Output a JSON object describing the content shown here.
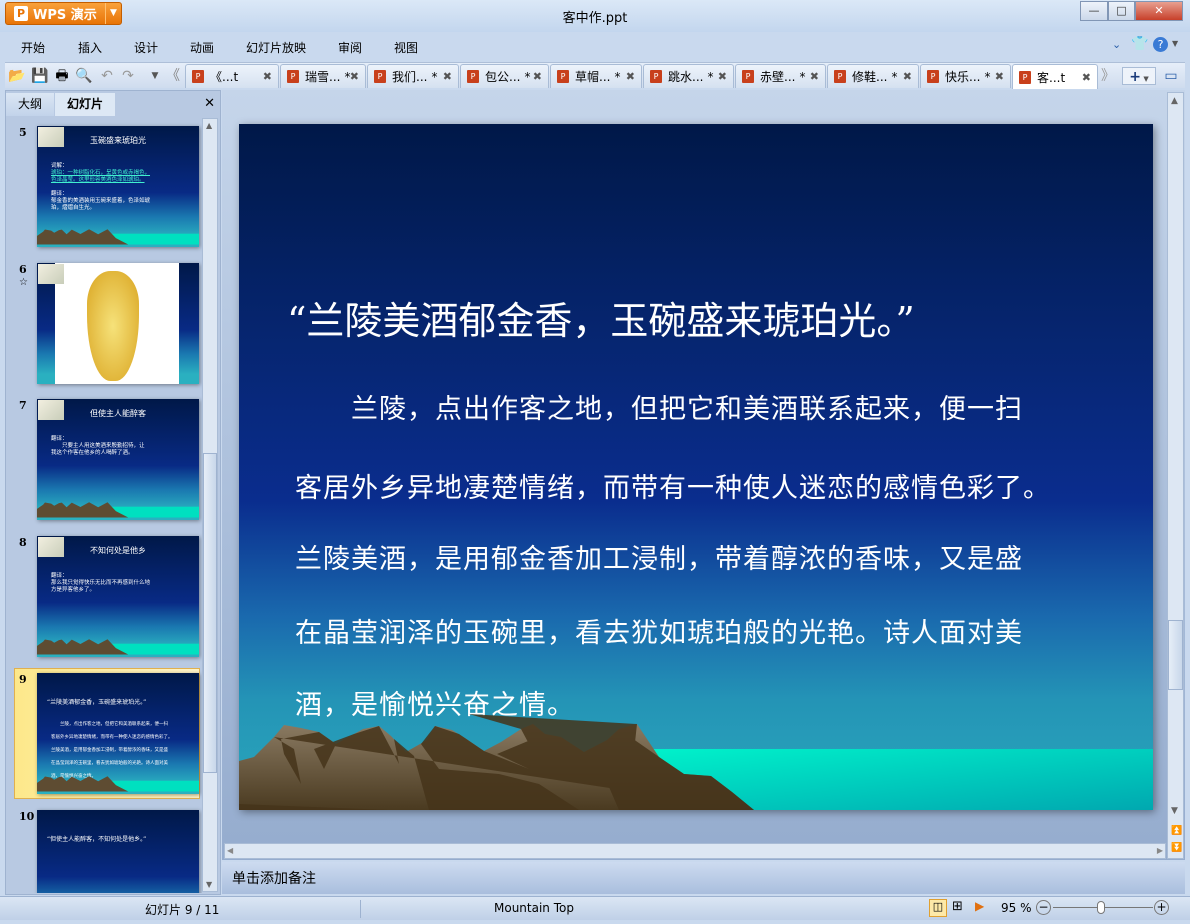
{
  "app": {
    "name": "WPS 演示",
    "doc_title": "客中作.ppt"
  },
  "window_controls": {
    "minimize": "—",
    "maximize": "□",
    "close": "✕"
  },
  "menu": [
    "开始",
    "插入",
    "设计",
    "动画",
    "幻灯片放映",
    "审阅",
    "视图"
  ],
  "toolbar_icons": [
    "open-icon",
    "save-icon",
    "print-icon",
    "print-preview-icon",
    "undo-icon",
    "redo-icon",
    "customize-icon",
    "scroll-left-icon"
  ],
  "doc_tabs": [
    {
      "label": "《...t",
      "modified": ""
    },
    {
      "label": "瑞雪...",
      "modified": "*"
    },
    {
      "label": "我们...",
      "modified": "*"
    },
    {
      "label": "包公...",
      "modified": "*"
    },
    {
      "label": "草帽...",
      "modified": "*"
    },
    {
      "label": "跳水...",
      "modified": "*"
    },
    {
      "label": "赤壁...",
      "modified": "*"
    },
    {
      "label": "修鞋...",
      "modified": "*"
    },
    {
      "label": "快乐...",
      "modified": "*"
    },
    {
      "label": "客...t",
      "modified": "",
      "active": true
    }
  ],
  "panel": {
    "tabs": [
      "大纲",
      "幻灯片"
    ],
    "active_tab": "幻灯片",
    "close": "✕"
  },
  "thumbnails": [
    {
      "num": "5",
      "title": "玉碗盛来琥珀光",
      "lines": [
        "词解：",
        "琥珀：一种树脂化石，呈黄色或赤褐色，",
        "色泽晶莹。这里形容美酒色泽如琥珀。",
        "",
        "翻译：",
        "郁金香的美酒装用玉碗来盛着，色泽如琥",
        "珀，熠熠自生光。"
      ]
    },
    {
      "num": "6",
      "title": "",
      "lines": [],
      "star": "☆"
    },
    {
      "num": "7",
      "title": "但使主人能醉客",
      "lines": [
        "翻译：",
        "　　只要主人用这美酒来殷勤招待，让",
        "我这个作客在他乡的人喝醉了酒。"
      ]
    },
    {
      "num": "8",
      "title": "不知何处是他乡",
      "lines": [
        "翻译：",
        "那么我只觉得快乐无比而不再感到什么地",
        "方是异客他乡了。"
      ]
    },
    {
      "num": "9",
      "title": "“兰陵美酒郁金香，玉碗盛来琥珀光。”",
      "lines": [
        "　　兰陵，点出作客之地，但把它和美酒联系起来，便一扫",
        "客居外乡异地凄楚情绪，而带有一种使人迷恋的感情色彩了。",
        "兰陵美酒，是用郁金香加工浸制，带着醇浓的香味，又是盛",
        "在晶莹润泽的玉碗里，看去犹如琥珀般的光艳。诗人面对美",
        "酒，是愉悦兴奋之情。"
      ],
      "selected": true
    },
    {
      "num": "10",
      "title": "“但使主人能醉客，不知何处是他乡。”",
      "lines": []
    }
  ],
  "slide": {
    "title": "“兰陵美酒郁金香，玉碗盛来琥珀光。”",
    "body": [
      "　　兰陵，点出作客之地，但把它和美酒联系起来，便一扫",
      "客居外乡异地凄楚情绪，而带有一种使人迷恋的感情色彩了。",
      "兰陵美酒，是用郁金香加工浸制，带着醇浓的香味，又是盛",
      "在晶莹润泽的玉碗里，看去犹如琥珀般的光艳。诗人面对美",
      "酒，是愉悦兴奋之情。"
    ]
  },
  "notes": {
    "placeholder": "单击添加备注"
  },
  "status": {
    "slide_counter": "幻灯片 9 / 11",
    "theme": "Mountain Top",
    "zoom": "95 %",
    "zoom_level_percent": 95
  },
  "colors": {
    "wps_orange": "#f08a1e",
    "slide_navy": "#001848",
    "sea_cyan": "#00f0c8",
    "mountain": "#6e5c42"
  }
}
